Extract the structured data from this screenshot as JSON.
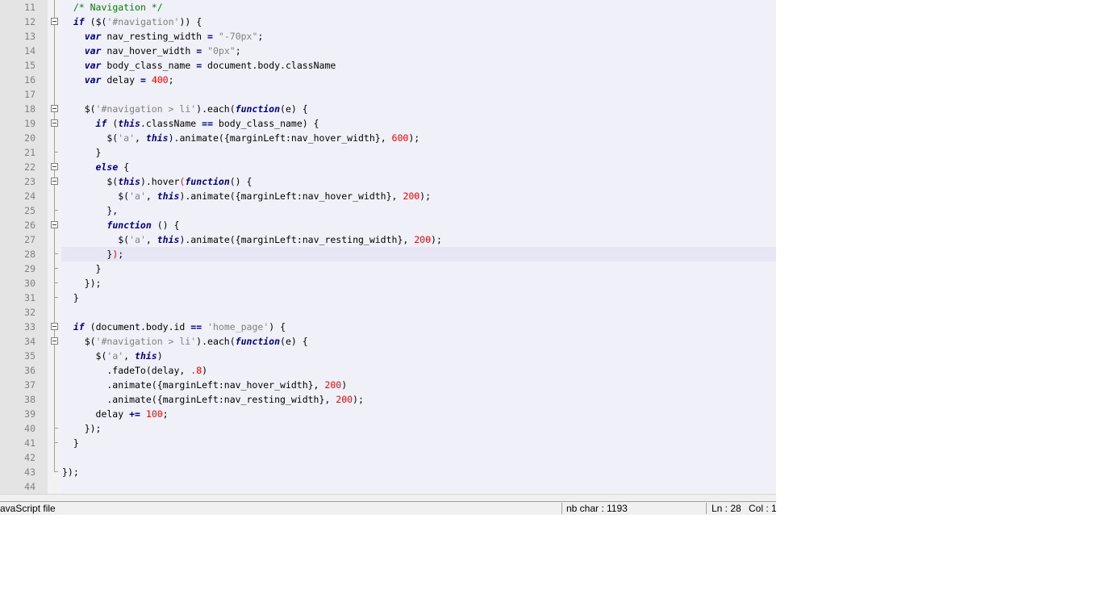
{
  "editor": {
    "current_line": 28,
    "lines": [
      {
        "n": "11",
        "fold": "vbar",
        "tokens": [
          [
            "plain",
            "  "
          ],
          [
            "com",
            "/* Navigation */"
          ]
        ]
      },
      {
        "n": "12",
        "fold": "box",
        "tokens": [
          [
            "plain",
            "  "
          ],
          [
            "kw",
            "if"
          ],
          [
            "plain",
            " ("
          ],
          [
            "plain",
            "$("
          ],
          [
            "str",
            "'#navigation'"
          ],
          [
            "plain",
            "))"
          ],
          [
            "plain",
            " {"
          ]
        ]
      },
      {
        "n": "13",
        "fold": "vbar",
        "tokens": [
          [
            "plain",
            "    "
          ],
          [
            "kw",
            "var"
          ],
          [
            "plain",
            " nav_resting_width "
          ],
          [
            "op",
            "="
          ],
          [
            "plain",
            " "
          ],
          [
            "str",
            "\"-70px\""
          ],
          [
            "plain",
            ";"
          ]
        ]
      },
      {
        "n": "14",
        "fold": "vbar",
        "tokens": [
          [
            "plain",
            "    "
          ],
          [
            "kw",
            "var"
          ],
          [
            "plain",
            " nav_hover_width "
          ],
          [
            "op",
            "="
          ],
          [
            "plain",
            " "
          ],
          [
            "str",
            "\"0px\""
          ],
          [
            "plain",
            ";"
          ]
        ]
      },
      {
        "n": "15",
        "fold": "vbar",
        "tokens": [
          [
            "plain",
            "    "
          ],
          [
            "kw",
            "var"
          ],
          [
            "plain",
            " body_class_name "
          ],
          [
            "op",
            "="
          ],
          [
            "plain",
            " document.body.className"
          ]
        ]
      },
      {
        "n": "16",
        "fold": "vbar",
        "tokens": [
          [
            "plain",
            "    "
          ],
          [
            "kw",
            "var"
          ],
          [
            "plain",
            " delay "
          ],
          [
            "op",
            "="
          ],
          [
            "plain",
            " "
          ],
          [
            "num",
            "400"
          ],
          [
            "plain",
            ";"
          ]
        ]
      },
      {
        "n": "17",
        "fold": "vbar",
        "tokens": []
      },
      {
        "n": "18",
        "fold": "box",
        "tokens": [
          [
            "plain",
            "    $("
          ],
          [
            "str",
            "'#navigation > li'"
          ],
          [
            "plain",
            ").each("
          ],
          [
            "kw",
            "function"
          ],
          [
            "plain",
            "(e) {"
          ]
        ]
      },
      {
        "n": "19",
        "fold": "box",
        "tokens": [
          [
            "plain",
            "      "
          ],
          [
            "kw",
            "if"
          ],
          [
            "plain",
            " ("
          ],
          [
            "kw",
            "this"
          ],
          [
            "plain",
            ".className "
          ],
          [
            "op",
            "=="
          ],
          [
            "plain",
            " body_class_name) {"
          ]
        ]
      },
      {
        "n": "20",
        "fold": "vbar",
        "tokens": [
          [
            "plain",
            "        $("
          ],
          [
            "str",
            "'a'"
          ],
          [
            "plain",
            ", "
          ],
          [
            "kw",
            "this"
          ],
          [
            "plain",
            ").animate({marginLeft:nav_hover_width}, "
          ],
          [
            "num",
            "600"
          ],
          [
            "plain",
            ");"
          ]
        ]
      },
      {
        "n": "21",
        "fold": "tick",
        "tokens": [
          [
            "plain",
            "      }"
          ]
        ]
      },
      {
        "n": "22",
        "fold": "box",
        "tokens": [
          [
            "plain",
            "      "
          ],
          [
            "kw",
            "else"
          ],
          [
            "plain",
            " {"
          ]
        ]
      },
      {
        "n": "23",
        "fold": "box",
        "tokens": [
          [
            "plain",
            "        $("
          ],
          [
            "kw",
            "this"
          ],
          [
            "plain",
            ").hover"
          ],
          [
            "brk",
            "("
          ],
          [
            "kw",
            "function"
          ],
          [
            "plain",
            "() {"
          ]
        ]
      },
      {
        "n": "24",
        "fold": "vbar",
        "tokens": [
          [
            "plain",
            "          $("
          ],
          [
            "str",
            "'a'"
          ],
          [
            "plain",
            ", "
          ],
          [
            "kw",
            "this"
          ],
          [
            "plain",
            ").animate({marginLeft:nav_hover_width}, "
          ],
          [
            "num",
            "200"
          ],
          [
            "plain",
            ");"
          ]
        ]
      },
      {
        "n": "25",
        "fold": "tick",
        "tokens": [
          [
            "plain",
            "        },"
          ]
        ]
      },
      {
        "n": "26",
        "fold": "box",
        "tokens": [
          [
            "plain",
            "        "
          ],
          [
            "kw",
            "function"
          ],
          [
            "plain",
            " () {"
          ]
        ]
      },
      {
        "n": "27",
        "fold": "vbar",
        "tokens": [
          [
            "plain",
            "          $("
          ],
          [
            "str",
            "'a'"
          ],
          [
            "plain",
            ", "
          ],
          [
            "kw",
            "this"
          ],
          [
            "plain",
            ").animate({marginLeft:nav_resting_width}, "
          ],
          [
            "num",
            "200"
          ],
          [
            "plain",
            ");"
          ]
        ]
      },
      {
        "n": "28",
        "fold": "tick",
        "tokens": [
          [
            "plain",
            "        }"
          ],
          [
            "brk",
            ")"
          ],
          [
            "plain",
            ";"
          ]
        ]
      },
      {
        "n": "29",
        "fold": "tick",
        "tokens": [
          [
            "plain",
            "      }"
          ]
        ]
      },
      {
        "n": "30",
        "fold": "tick",
        "tokens": [
          [
            "plain",
            "    });"
          ]
        ]
      },
      {
        "n": "31",
        "fold": "tick",
        "tokens": [
          [
            "plain",
            "  }"
          ]
        ]
      },
      {
        "n": "32",
        "fold": "vbar",
        "tokens": []
      },
      {
        "n": "33",
        "fold": "box",
        "tokens": [
          [
            "plain",
            "  "
          ],
          [
            "kw",
            "if"
          ],
          [
            "plain",
            " (document.body.id "
          ],
          [
            "op",
            "=="
          ],
          [
            "plain",
            " "
          ],
          [
            "str",
            "'home_page'"
          ],
          [
            "plain",
            ") {"
          ]
        ]
      },
      {
        "n": "34",
        "fold": "box",
        "tokens": [
          [
            "plain",
            "    $("
          ],
          [
            "str",
            "'#navigation > li'"
          ],
          [
            "plain",
            ").each("
          ],
          [
            "kw",
            "function"
          ],
          [
            "plain",
            "(e) {"
          ]
        ]
      },
      {
        "n": "35",
        "fold": "vbar",
        "tokens": [
          [
            "plain",
            "      $("
          ],
          [
            "str",
            "'a'"
          ],
          [
            "plain",
            ", "
          ],
          [
            "kw",
            "this"
          ],
          [
            "plain",
            ")"
          ]
        ]
      },
      {
        "n": "36",
        "fold": "vbar",
        "tokens": [
          [
            "plain",
            "        .fadeTo(delay, "
          ],
          [
            "num",
            ".8"
          ],
          [
            "plain",
            ")"
          ]
        ]
      },
      {
        "n": "37",
        "fold": "vbar",
        "tokens": [
          [
            "plain",
            "        .animate({marginLeft:nav_hover_width}, "
          ],
          [
            "num",
            "200"
          ],
          [
            "plain",
            ")"
          ]
        ]
      },
      {
        "n": "38",
        "fold": "vbar",
        "tokens": [
          [
            "plain",
            "        .animate({marginLeft:nav_resting_width}, "
          ],
          [
            "num",
            "200"
          ],
          [
            "plain",
            ");"
          ]
        ]
      },
      {
        "n": "39",
        "fold": "vbar",
        "tokens": [
          [
            "plain",
            "      delay "
          ],
          [
            "op",
            "+="
          ],
          [
            "plain",
            " "
          ],
          [
            "num",
            "100"
          ],
          [
            "plain",
            ";"
          ]
        ]
      },
      {
        "n": "40",
        "fold": "tick",
        "tokens": [
          [
            "plain",
            "    });"
          ]
        ]
      },
      {
        "n": "41",
        "fold": "tick",
        "tokens": [
          [
            "plain",
            "  }"
          ]
        ]
      },
      {
        "n": "42",
        "fold": "vbar",
        "tokens": []
      },
      {
        "n": "43",
        "fold": "end",
        "tokens": [
          [
            "plain",
            "});"
          ]
        ]
      },
      {
        "n": "44",
        "fold": "none",
        "tokens": []
      }
    ]
  },
  "statusbar": {
    "file_type": "avaScript file",
    "char_count": "nb char : 1193",
    "line": "Ln : 28",
    "col": "Col : 1"
  },
  "colors": {
    "comment": "#008000",
    "keyword": "#000080",
    "string": "#808080",
    "number": "#ff0000",
    "current_line_bg": "#e6e6f4"
  }
}
